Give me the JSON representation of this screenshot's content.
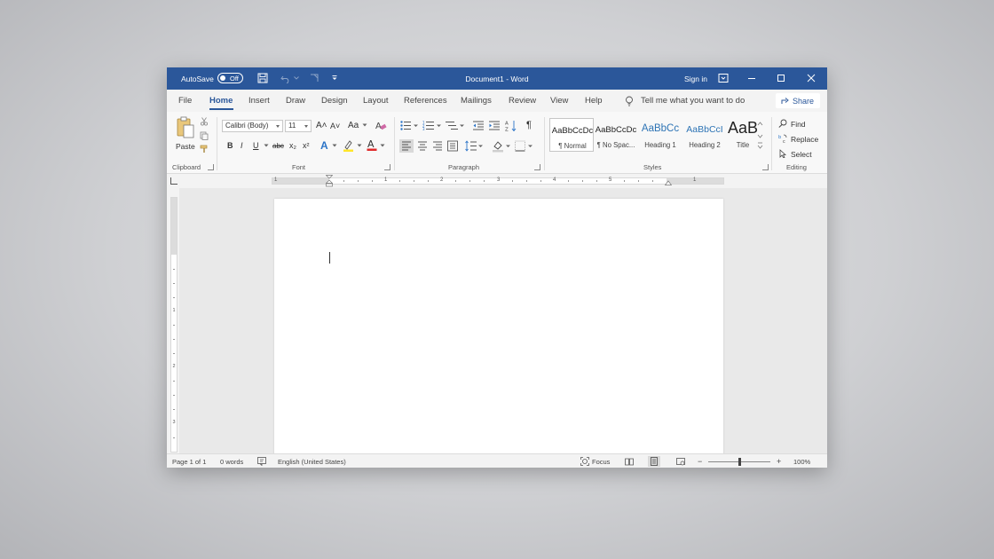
{
  "titlebar": {
    "autosave_label": "AutoSave",
    "autosave_state": "Off",
    "doc_title": "Document1 - Word",
    "signin_label": "Sign in",
    "accent_color": "#2b579a"
  },
  "tabs": {
    "items": [
      "File",
      "Home",
      "Insert",
      "Draw",
      "Design",
      "Layout",
      "References",
      "Mailings",
      "Review",
      "View",
      "Help"
    ],
    "active": "Home",
    "tell_me_placeholder": "Tell me what you want to do",
    "share_label": "Share"
  },
  "ribbon": {
    "clipboard": {
      "paste_label": "Paste",
      "group_label": "Clipboard"
    },
    "font": {
      "font_name": "Calibri (Body)",
      "font_size": "11",
      "grow_font": "A˄",
      "shrink_font": "A˅",
      "change_case": "Aa",
      "bold": "B",
      "italic": "I",
      "underline": "U",
      "strikethrough": "abc",
      "subscript": "x₂",
      "superscript": "x²",
      "text_effects": "A",
      "font_color": "A",
      "group_label": "Font"
    },
    "paragraph": {
      "sort": "A↓Z",
      "show_marks": "¶",
      "group_label": "Paragraph"
    },
    "styles": {
      "items": [
        {
          "sample": "AaBbCcDc",
          "name": "¶ Normal"
        },
        {
          "sample": "AaBbCcDc",
          "name": "¶ No Spac..."
        },
        {
          "sample": "AaBbCc",
          "name": "Heading 1"
        },
        {
          "sample": "AaBbCcI",
          "name": "Heading 2"
        },
        {
          "sample": "AaB",
          "name": "Title"
        }
      ],
      "group_label": "Styles"
    },
    "editing": {
      "find_label": "Find",
      "replace_label": "Replace",
      "select_label": "Select",
      "group_label": "Editing"
    }
  },
  "ruler": {
    "numbers": [
      "1",
      "1",
      "2",
      "3",
      "4",
      "5",
      "1"
    ]
  },
  "vruler": {
    "numbers": [
      "1",
      "2",
      "3"
    ]
  },
  "statusbar": {
    "page": "Page 1 of 1",
    "words": "0 words",
    "language": "English (United States)",
    "focus_label": "Focus",
    "zoom_minus": "−",
    "zoom_plus": "+",
    "zoom_level": "100%"
  }
}
